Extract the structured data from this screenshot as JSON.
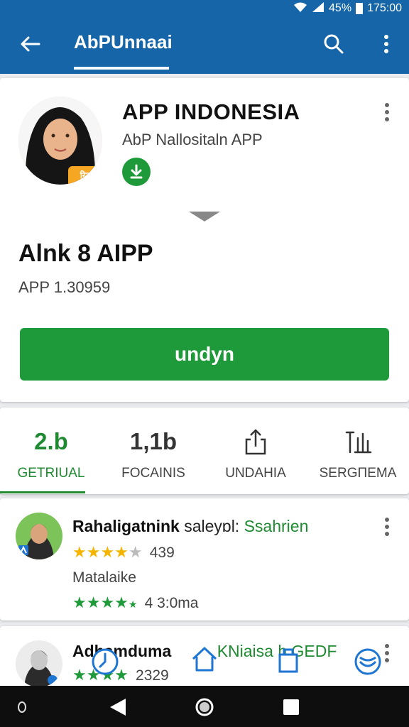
{
  "status_bar": {
    "battery": "45%",
    "time": "175:00"
  },
  "app_bar": {
    "title": "AbPUnnaai",
    "back_icon": "arrow-left-icon",
    "search_icon": "search-icon",
    "more_icon": "more-vert-icon"
  },
  "app": {
    "name": "APP  INDONESIA",
    "subtitle": "AbP Nallositaln APP",
    "avatar_badge": "रिड",
    "headline": "Alnk 8 AIPP",
    "version": "APP  1.30959",
    "install_label": "undyn",
    "colors": {
      "primary": "#1565a8",
      "accent": "#1f9a3a",
      "badge": "#f5a623"
    }
  },
  "stats": [
    {
      "value": "2.b",
      "label": "GETRIUAL",
      "active": true
    },
    {
      "value": "1,1b",
      "label": "FOCAINIS",
      "active": false
    },
    {
      "value": "",
      "icon": "share-icon",
      "label": "UNDAHIA",
      "active": false
    },
    {
      "value": "",
      "icon": "chart-hand-icon",
      "label": "SERGΠEMA",
      "active": false
    }
  ],
  "list": [
    {
      "title": "Rahaligatnink",
      "title_mid": "saleyɒl:",
      "title_tag": "Ssahrien",
      "rating_count": "439",
      "description": "Matalaike",
      "rating2_count": "4 3:0ma"
    },
    {
      "title": "Adhamduma",
      "title_tag": "KNiaisa h GEDF",
      "rating_count": "2329"
    }
  ],
  "nav": {
    "back_icon": "triangle-back-icon",
    "home_icon": "circle-home-icon",
    "recent_icon": "square-recent-icon"
  }
}
